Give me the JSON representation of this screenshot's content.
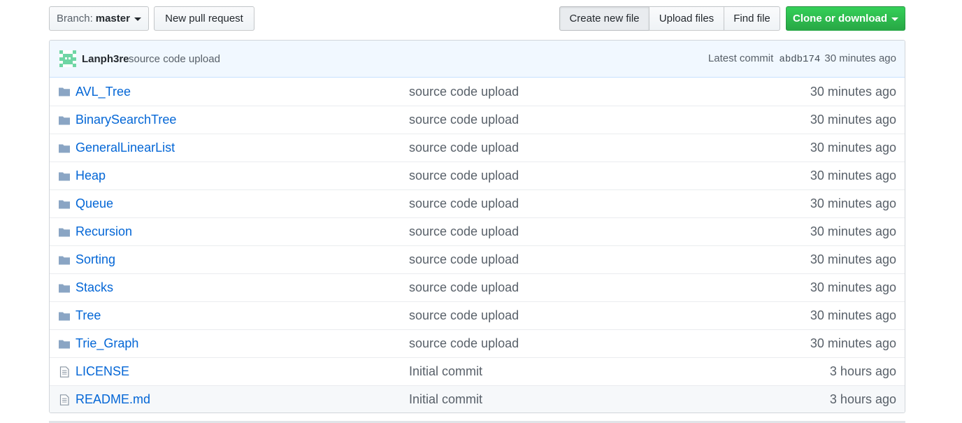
{
  "toolbar": {
    "branch_label": "Branch:",
    "branch_value": "master",
    "new_pr": "New pull request",
    "create_file": "Create new file",
    "upload_files": "Upload files",
    "find_file": "Find file",
    "clone": "Clone or download"
  },
  "commit": {
    "author": "Lanph3re",
    "message": "source code upload",
    "latest_label": "Latest commit",
    "sha": "abdb174",
    "age": "30 minutes ago"
  },
  "files": [
    {
      "type": "folder",
      "name": "AVL_Tree",
      "message": "source code upload",
      "age": "30 minutes ago"
    },
    {
      "type": "folder",
      "name": "BinarySearchTree",
      "message": "source code upload",
      "age": "30 minutes ago"
    },
    {
      "type": "folder",
      "name": "GeneralLinearList",
      "message": "source code upload",
      "age": "30 minutes ago"
    },
    {
      "type": "folder",
      "name": "Heap",
      "message": "source code upload",
      "age": "30 minutes ago"
    },
    {
      "type": "folder",
      "name": "Queue",
      "message": "source code upload",
      "age": "30 minutes ago"
    },
    {
      "type": "folder",
      "name": "Recursion",
      "message": "source code upload",
      "age": "30 minutes ago"
    },
    {
      "type": "folder",
      "name": "Sorting",
      "message": "source code upload",
      "age": "30 minutes ago"
    },
    {
      "type": "folder",
      "name": "Stacks",
      "message": "source code upload",
      "age": "30 minutes ago"
    },
    {
      "type": "folder",
      "name": "Tree",
      "message": "source code upload",
      "age": "30 minutes ago"
    },
    {
      "type": "folder",
      "name": "Trie_Graph",
      "message": "source code upload",
      "age": "30 minutes ago"
    },
    {
      "type": "file",
      "name": "LICENSE",
      "message": "Initial commit",
      "age": "3 hours ago"
    },
    {
      "type": "file",
      "name": "README.md",
      "message": "Initial commit",
      "age": "3 hours ago"
    }
  ],
  "colors": {
    "link": "#0366d6",
    "folder_icon": "#79b8ff",
    "clone_bg": "#28a745",
    "commit_bar_bg": "#f1f8ff"
  }
}
